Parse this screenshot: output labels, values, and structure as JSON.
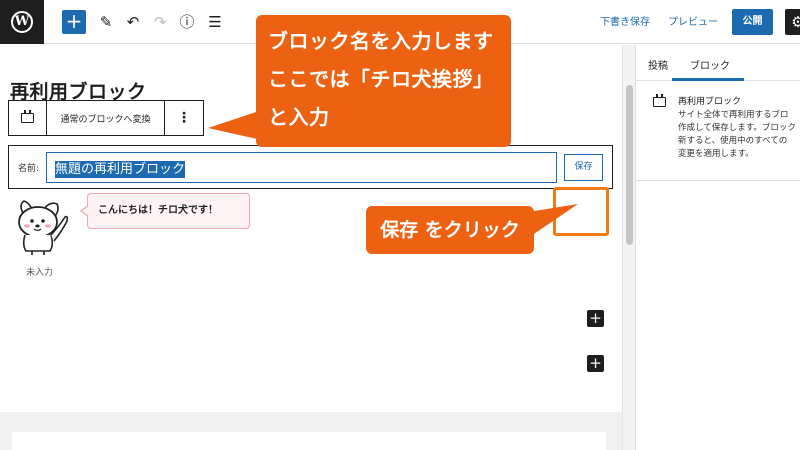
{
  "topbar": {
    "logo": "W",
    "add_icon": "+",
    "edit_icon": "✎",
    "undo_icon": "↶",
    "redo_icon": "↷",
    "info_icon": "ⓘ",
    "list_icon": "☰",
    "save_draft": "下書き保存",
    "preview": "プレビュー",
    "publish": "公開",
    "settings_icon": "⚙"
  },
  "editor": {
    "title": "再利用ブロック",
    "block_toolbar": {
      "convert_label": "通常のブロックへ変換",
      "more_icon": "⋮"
    },
    "name_field": {
      "label": "名前:",
      "value": "無題の再利用ブロック",
      "save_label": "保存"
    },
    "mascot_caption": "未入力",
    "speech": "こんにちは！チロ犬です！",
    "inserter_icon": "+"
  },
  "sidebar": {
    "tabs": [
      "投稿",
      "ブロック"
    ],
    "active_tab": "ブロック",
    "block_title": "再利用ブロック",
    "block_desc_lines": [
      "サイト全体で再利用するブロ",
      "作成して保存します。ブロック",
      "新すると、使用中のすべての",
      "変更を適用します。"
    ]
  },
  "annotations": {
    "name_callout_lines": [
      "ブロック名を入力します",
      "ここでは「チロ犬挨拶」",
      "と入力"
    ],
    "save_callout": "保存 をクリック"
  },
  "colors": {
    "accent": "#1e6ab1",
    "annotation": "#ec6212",
    "speech_border": "#f2a6b6"
  }
}
